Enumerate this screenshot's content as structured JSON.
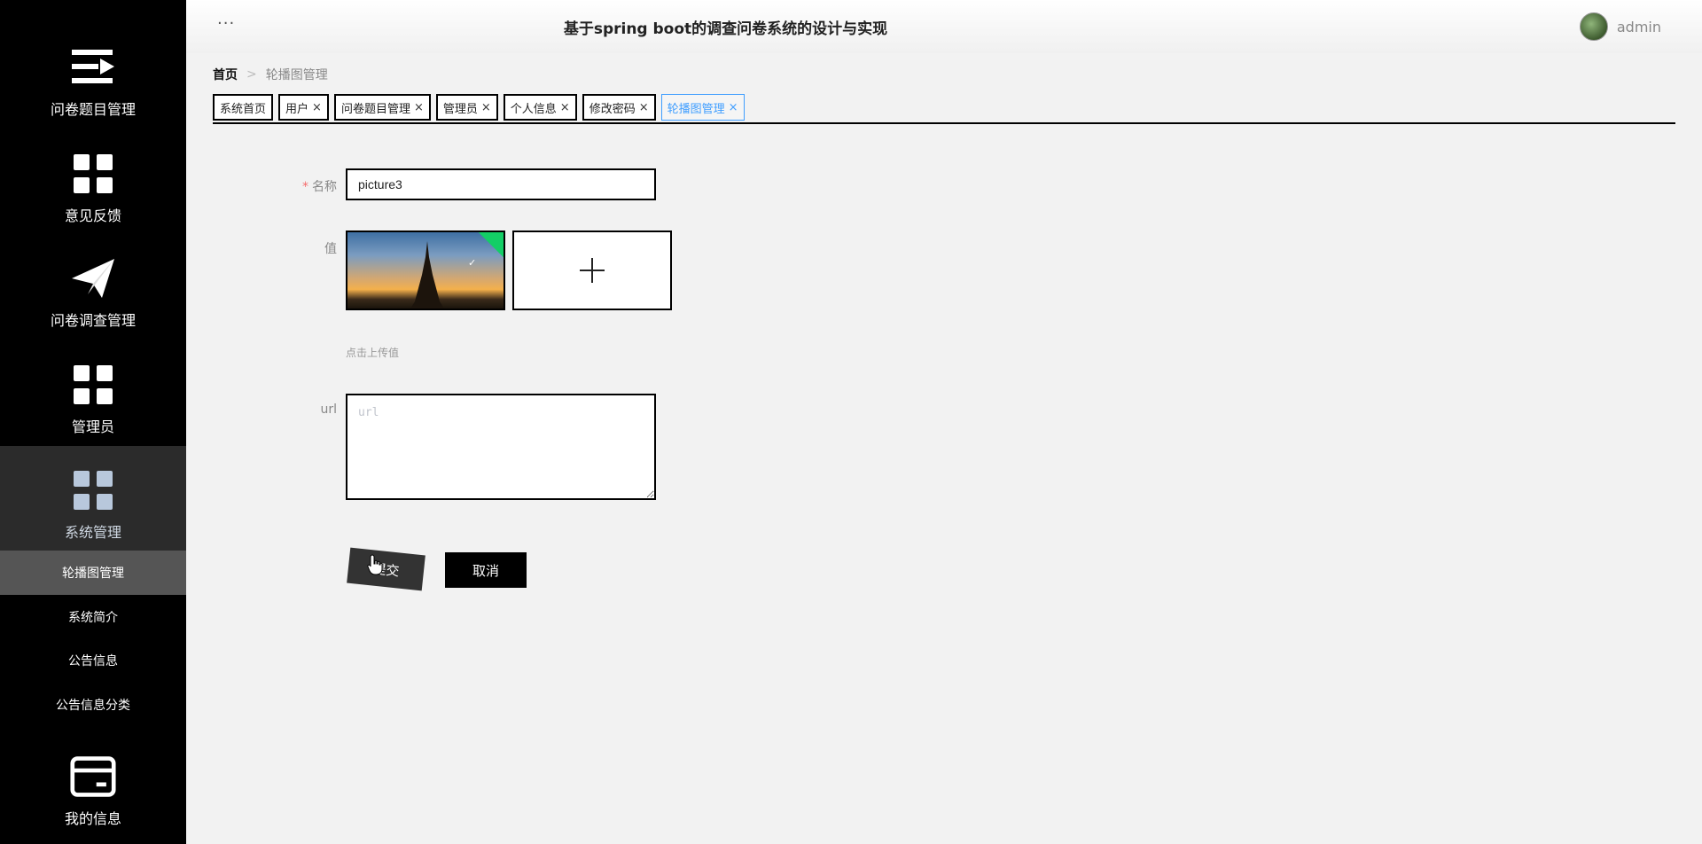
{
  "header": {
    "menu_icon": "ellipsis-icon",
    "title": "基于spring boot的调查问卷系统的设计与实现",
    "username": "admin"
  },
  "sidebar": {
    "menus": [
      {
        "label": "问卷题目管理",
        "icon": "list-icon"
      },
      {
        "label": "意见反馈",
        "icon": "grid-icon"
      },
      {
        "label": "问卷调查管理",
        "icon": "paper-plane-icon"
      },
      {
        "label": "管理员",
        "icon": "grid-icon"
      },
      {
        "label": "系统管理",
        "icon": "grid-icon"
      },
      {
        "label": "我的信息",
        "icon": "card-icon"
      }
    ],
    "submenu": [
      "轮播图管理",
      "系统简介",
      "公告信息",
      "公告信息分类"
    ],
    "selected_submenu": "轮播图管理"
  },
  "breadcrumb": {
    "home": "首页",
    "separator": ">",
    "current": "轮播图管理"
  },
  "tabs": [
    {
      "label": "系统首页",
      "closable": false
    },
    {
      "label": "用户",
      "closable": true
    },
    {
      "label": "问卷题目管理",
      "closable": true
    },
    {
      "label": "管理员",
      "closable": true
    },
    {
      "label": "个人信息",
      "closable": true
    },
    {
      "label": "修改密码",
      "closable": true
    },
    {
      "label": "轮播图管理",
      "closable": true,
      "active": true
    }
  ],
  "tab_close_glyph": "×",
  "form": {
    "name_label": "名称",
    "name_required_mark": "*",
    "name_value": "picture3",
    "value_label": "值",
    "upload_tip": "点击上传值",
    "url_label": "url",
    "url_placeholder": "url",
    "submit_label": "提交",
    "cancel_label": "取消"
  },
  "colors": {
    "sidebar_bg": "#000000",
    "active_tab": "#409eff",
    "upload_success": "#13ce66"
  }
}
